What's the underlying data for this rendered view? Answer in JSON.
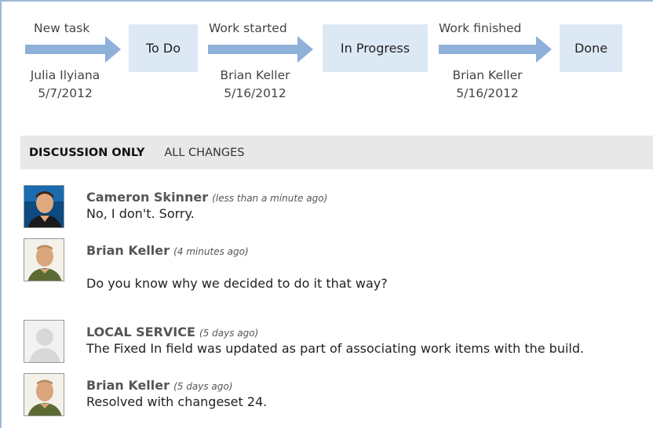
{
  "workflow": {
    "states": [
      "To Do",
      "In Progress",
      "Done"
    ],
    "transitions": [
      {
        "label": "New task",
        "who": "Julia Ilyiana",
        "date": "5/7/2012"
      },
      {
        "label": "Work started",
        "who": "Brian Keller",
        "date": "5/16/2012"
      },
      {
        "label": "Work finished",
        "who": "Brian Keller",
        "date": "5/16/2012"
      }
    ],
    "colors": {
      "arrow": "#8eb0d9",
      "state_fill": "#dde8f5"
    }
  },
  "filters": {
    "discussion_only": "DISCUSSION ONLY",
    "all_changes": "ALL CHANGES"
  },
  "discussion": [
    {
      "author": "Cameron Skinner",
      "time": "(less than a minute ago)",
      "message": "No, I don't. Sorry.",
      "avatar": "cameron-photo"
    },
    {
      "author": "Brian Keller",
      "time": "(4 minutes ago)",
      "message": "Do you know why we decided to do it that way?",
      "avatar": "brian-photo"
    },
    {
      "author": "LOCAL SERVICE",
      "time": "(5 days ago)",
      "message": "The Fixed In field was updated as part of associating work items with the build.",
      "avatar": "generic-user"
    },
    {
      "author": "Brian Keller",
      "time": "(5 days ago)",
      "message": "Resolved with changeset 24.",
      "avatar": "brian-photo"
    }
  ]
}
